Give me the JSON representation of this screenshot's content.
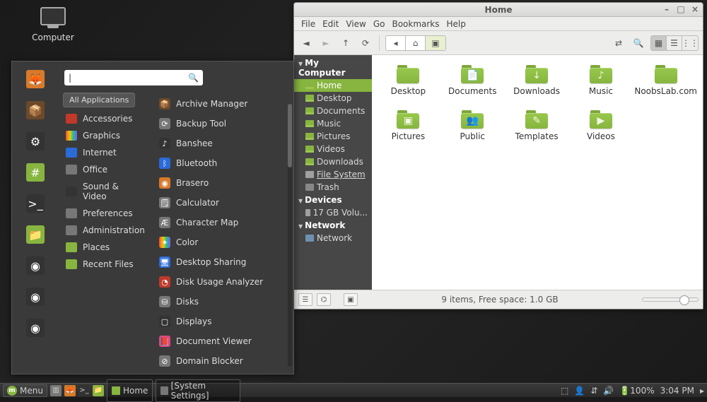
{
  "desktop": {
    "computer_label": "Computer"
  },
  "filemanager": {
    "title": "Home",
    "menubar": [
      "File",
      "Edit",
      "View",
      "Go",
      "Bookmarks",
      "Help"
    ],
    "breadcrumb": [
      {
        "name": "previous",
        "glyph": "◂"
      },
      {
        "name": "home",
        "glyph": "⌂"
      },
      {
        "name": "current",
        "glyph": "▣"
      }
    ],
    "sidebar": {
      "sections": [
        {
          "label": "My Computer",
          "items": [
            {
              "label": "Home",
              "icon": "folder",
              "sel": true
            },
            {
              "label": "Desktop",
              "icon": "folder"
            },
            {
              "label": "Documents",
              "icon": "folder"
            },
            {
              "label": "Music",
              "icon": "folder"
            },
            {
              "label": "Pictures",
              "icon": "folder"
            },
            {
              "label": "Videos",
              "icon": "folder"
            },
            {
              "label": "Downloads",
              "icon": "folder"
            },
            {
              "label": "File System",
              "icon": "disk",
              "underline": true
            },
            {
              "label": "Trash",
              "icon": "trash"
            }
          ]
        },
        {
          "label": "Devices",
          "items": [
            {
              "label": "17 GB Volu...",
              "icon": "disk"
            }
          ]
        },
        {
          "label": "Network",
          "items": [
            {
              "label": "Network",
              "icon": "net"
            }
          ]
        }
      ]
    },
    "items": [
      {
        "label": "Desktop",
        "glyph": ""
      },
      {
        "label": "Documents",
        "glyph": "📄"
      },
      {
        "label": "Downloads",
        "glyph": "↓"
      },
      {
        "label": "Music",
        "glyph": "♪"
      },
      {
        "label": "NoobsLab.com",
        "glyph": ""
      },
      {
        "label": "Pictures",
        "glyph": "▣"
      },
      {
        "label": "Public",
        "glyph": "👥"
      },
      {
        "label": "Templates",
        "glyph": "✎"
      },
      {
        "label": "Videos",
        "glyph": "▶"
      }
    ],
    "status": "9 items, Free space: 1.0 GB"
  },
  "mintmenu": {
    "favorites": [
      {
        "name": "firefox",
        "color": "c-orange",
        "glyph": "🦊"
      },
      {
        "name": "package",
        "color": "c-brown",
        "glyph": "📦"
      },
      {
        "name": "settings",
        "color": "c-dark",
        "glyph": "⚙"
      },
      {
        "name": "terminal-fav",
        "color": "c-green",
        "glyph": "#"
      },
      {
        "name": "console",
        "color": "c-dark",
        "glyph": ">_"
      },
      {
        "name": "files",
        "color": "c-green",
        "glyph": "📁"
      },
      {
        "name": "disc1",
        "color": "c-dark",
        "glyph": "◉"
      },
      {
        "name": "disc2",
        "color": "c-dark",
        "glyph": "◉"
      },
      {
        "name": "disc3",
        "color": "c-dark",
        "glyph": "◉"
      }
    ],
    "all_applications_label": "All Applications",
    "search_placeholder": "",
    "categories": [
      {
        "label": "Accessories",
        "color": "c-red"
      },
      {
        "label": "Graphics",
        "color": "c-rainbow"
      },
      {
        "label": "Internet",
        "color": "c-blue"
      },
      {
        "label": "Office",
        "color": "c-gray"
      },
      {
        "label": "Sound & Video",
        "color": "c-dark"
      },
      {
        "label": "Preferences",
        "color": "c-gray"
      },
      {
        "label": "Administration",
        "color": "c-gray"
      },
      {
        "label": "Places",
        "color": "c-green"
      },
      {
        "label": "Recent Files",
        "color": "c-green"
      }
    ],
    "apps": [
      {
        "label": "Archive Manager",
        "color": "c-brown",
        "glyph": "📦"
      },
      {
        "label": "Backup Tool",
        "color": "c-gray",
        "glyph": "⟳"
      },
      {
        "label": "Banshee",
        "color": "c-dark",
        "glyph": "♪"
      },
      {
        "label": "Bluetooth",
        "color": "c-blue",
        "glyph": "ᛒ"
      },
      {
        "label": "Brasero",
        "color": "c-orange",
        "glyph": "◉"
      },
      {
        "label": "Calculator",
        "color": "c-gray",
        "glyph": "🗒"
      },
      {
        "label": "Character Map",
        "color": "c-gray",
        "glyph": "Æ"
      },
      {
        "label": "Color",
        "color": "c-rainbow",
        "glyph": "✦"
      },
      {
        "label": "Desktop Sharing",
        "color": "c-blue",
        "glyph": "🖥"
      },
      {
        "label": "Disk Usage Analyzer",
        "color": "c-red",
        "glyph": "◔"
      },
      {
        "label": "Disks",
        "color": "c-gray",
        "glyph": "⛁"
      },
      {
        "label": "Displays",
        "color": "c-dark",
        "glyph": "▢"
      },
      {
        "label": "Document Viewer",
        "color": "c-pink",
        "glyph": "📕"
      },
      {
        "label": "Domain Blocker",
        "color": "c-gray",
        "glyph": "⊘"
      }
    ]
  },
  "panel": {
    "menu_label": "Menu",
    "tasks": [
      {
        "label": "Home",
        "icon": "c-green"
      },
      {
        "label": "[System Settings]",
        "icon": "c-gray"
      }
    ],
    "battery": "100%",
    "clock": "3:04 PM"
  }
}
